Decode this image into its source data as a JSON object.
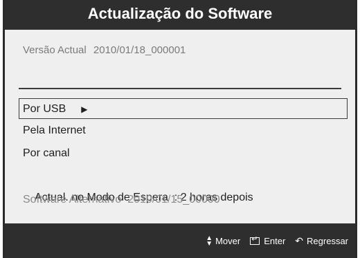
{
  "title": "Actualização do Software",
  "current_version": {
    "label": "Versão Actual",
    "value": "2010/01/18_000001"
  },
  "menu": {
    "items": [
      {
        "label": "Por USB",
        "selected": true,
        "arrow": "▶"
      },
      {
        "label": "Pela Internet"
      },
      {
        "label": "Por canal"
      },
      {
        "label": "Actual. no Modo de Espera  : 2 horas depois"
      },
      {
        "label": "Software Alternativo  2010/01/15_00000",
        "disabled": true
      }
    ]
  },
  "footer": {
    "move_label": "Mover",
    "enter_label": "Enter",
    "back_label": "Regressar",
    "move_icon": "up-down-arrows-icon",
    "enter_icon": "enter-icon",
    "back_icon": "return-icon"
  },
  "colors": {
    "bar": "#2e2e2e",
    "panel": "#efefef",
    "disabled_text": "#8a8a8a"
  }
}
